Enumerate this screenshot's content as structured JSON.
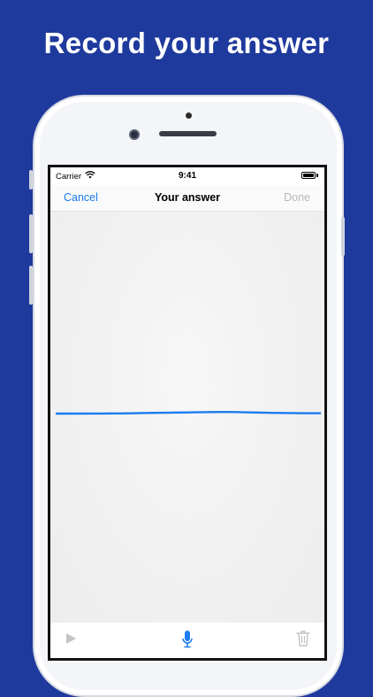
{
  "headline": "Record your answer",
  "status_bar": {
    "carrier": "Carrier",
    "time": "9:41",
    "icons": [
      "wifi-icon",
      "battery-icon"
    ]
  },
  "nav": {
    "cancel_label": "Cancel",
    "title": "Your answer",
    "done_label": "Done"
  },
  "toolbar": {
    "icons": [
      "play-icon",
      "microphone-icon",
      "trash-icon"
    ]
  },
  "colors": {
    "background": "#1f3a9d",
    "accent": "#1a7cf0",
    "disabled": "#b9b9bd"
  }
}
